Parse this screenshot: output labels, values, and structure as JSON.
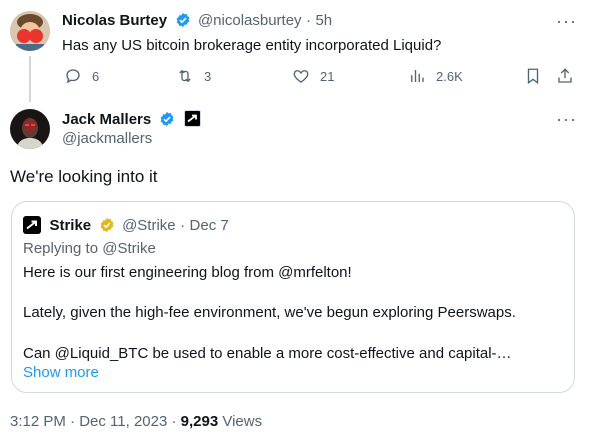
{
  "tweet1": {
    "name": "Nicolas Burtey",
    "handle": "@nicolasburtey",
    "sep": "·",
    "time": "5h",
    "text": "Has any US bitcoin brokerage entity incorporated Liquid?",
    "replies": "6",
    "retweets": "3",
    "likes": "21",
    "views": "2.6K",
    "more": "···"
  },
  "tweet2": {
    "name": "Jack Mallers",
    "handle": "@jackmallers",
    "text": "We're looking into it",
    "more": "···"
  },
  "quote": {
    "name": "Strike",
    "handle": "@Strike",
    "sep": "·",
    "date": "Dec 7",
    "replying_to": "Replying to @Strike",
    "line1": "Here is our first engineering blog from @mrfelton!",
    "line2": "Lately, given the high-fee environment, we've begun exploring Peerswaps.",
    "line3": "Can @Liquid_BTC be used to enable a more cost-effective and capital-…",
    "show_more": "Show more"
  },
  "footer": {
    "time": "3:12 PM · Dec 11, 2023 · ",
    "views_count": "9,293",
    "views_label": " Views"
  },
  "colors": {
    "accent": "#1d9bf0",
    "gold": "#e2b719",
    "muted": "#536471"
  }
}
